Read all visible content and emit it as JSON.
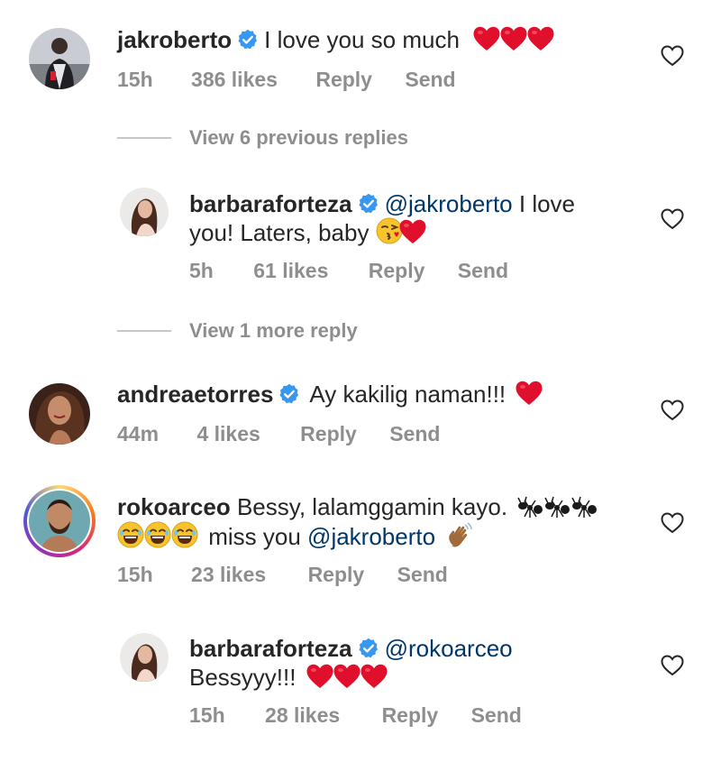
{
  "comments": [
    {
      "username": "jakroberto",
      "text": "I love you so much",
      "time": "15h",
      "likes": "386 likes",
      "reply": "Reply",
      "send": "Send"
    },
    {
      "view_replies": "View 6 previous replies"
    },
    {
      "username": "barbaraforteza",
      "mention": "@jakroberto",
      "text_a": "I love",
      "text_b": "you! Laters, baby",
      "time": "5h",
      "likes": "61 likes",
      "reply": "Reply",
      "send": "Send"
    },
    {
      "view_replies": "View 1 more reply"
    },
    {
      "username": "andreaetorres",
      "text": "Ay kakilig naman!!!",
      "time": "44m",
      "likes": "4 likes",
      "reply": "Reply",
      "send": "Send"
    },
    {
      "username": "rokoarceo",
      "text_a": "Bessy, lalamggamin kayo.",
      "text_b": "miss you",
      "mention": "@jakroberto",
      "time": "15h",
      "likes": "23 likes",
      "reply": "Reply",
      "send": "Send"
    },
    {
      "username": "barbaraforteza",
      "mention": "@rokoarceo",
      "text_b": "Bessyyy!!!",
      "time": "15h",
      "likes": "28 likes",
      "reply": "Reply",
      "send": "Send"
    }
  ],
  "colors": {
    "verified": "#3897f0",
    "heart_emoji": "#e0102c",
    "mention": "#00376b",
    "meta": "#8e8e8e"
  },
  "icons": [
    "verified-badge-icon",
    "like-heart-outline-icon",
    "red-heart-emoji",
    "kiss-face-emoji",
    "ant-emoji",
    "laughing-face-emoji",
    "waving-hand-emoji"
  ]
}
